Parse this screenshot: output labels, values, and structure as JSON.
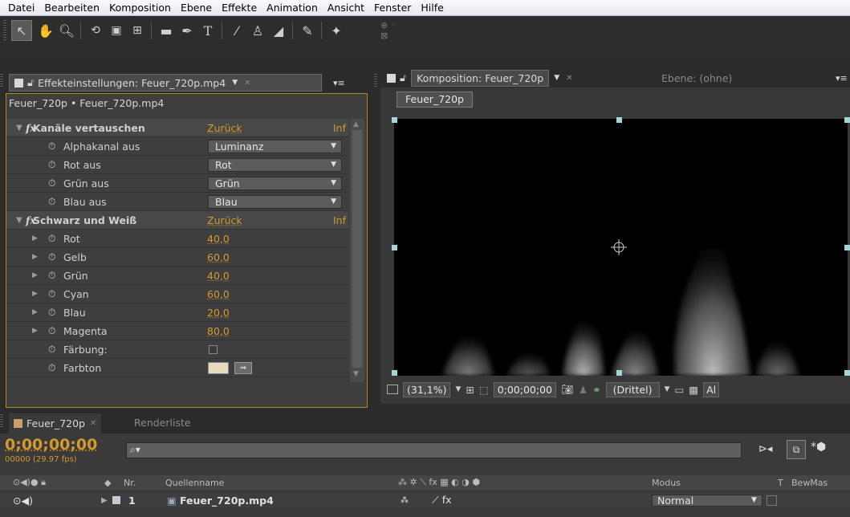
{
  "menu": [
    "Datei",
    "Bearbeiten",
    "Komposition",
    "Ebene",
    "Effekte",
    "Animation",
    "Ansicht",
    "Fenster",
    "Hilfe"
  ],
  "effects_panel": {
    "tab_title": "Effekteinstellungen: Feuer_720p.mp4",
    "subheader": "Feuer_720p • Feuer_720p.mp4",
    "effects": [
      {
        "name": "Kanäle vertauschen",
        "reset": "Zurück",
        "info": "Inf",
        "params": [
          {
            "name": "Alphakanal aus",
            "value": "Luminanz"
          },
          {
            "name": "Rot aus",
            "value": "Rot"
          },
          {
            "name": "Grün aus",
            "value": "Grün"
          },
          {
            "name": "Blau aus",
            "value": "Blau"
          }
        ]
      },
      {
        "name": "Schwarz und Weiß",
        "reset": "Zurück",
        "info": "Inf",
        "params": [
          {
            "name": "Rot",
            "value": "40,0"
          },
          {
            "name": "Gelb",
            "value": "60,0"
          },
          {
            "name": "Grün",
            "value": "40,0"
          },
          {
            "name": "Cyan",
            "value": "60,0"
          },
          {
            "name": "Blau",
            "value": "20,0"
          },
          {
            "name": "Magenta",
            "value": "80,0"
          },
          {
            "name": "Färbung:",
            "value": ""
          },
          {
            "name": "Farbton",
            "value": ""
          }
        ]
      }
    ]
  },
  "comp_panel": {
    "tab_title": "Komposition: Feuer_720p",
    "layer_tab": "Ebene: (ohne)",
    "comp_button": "Feuer_720p",
    "zoom": "(31,1%)",
    "timecode": "0;00;00;00",
    "grid": "(Drittel)",
    "extra": "Al"
  },
  "timeline": {
    "tab_active": "Feuer_720p",
    "tab_render": "Renderliste",
    "timecode": "0;00;00;00",
    "frames": "00000 (29.97 fps)",
    "col_nr": "Nr.",
    "col_source": "Quellenname",
    "col_mode": "Modus",
    "col_t": "T",
    "col_bewmas": "BewMas",
    "layer": {
      "nr": "1",
      "name": "Feuer_720p.mp4",
      "mode": "Normal"
    }
  },
  "colors": {
    "accent": "#d39a2c",
    "panel_border": "#b5871a",
    "handle": "#a4d4d7",
    "swatch": "#e8dcc0"
  }
}
